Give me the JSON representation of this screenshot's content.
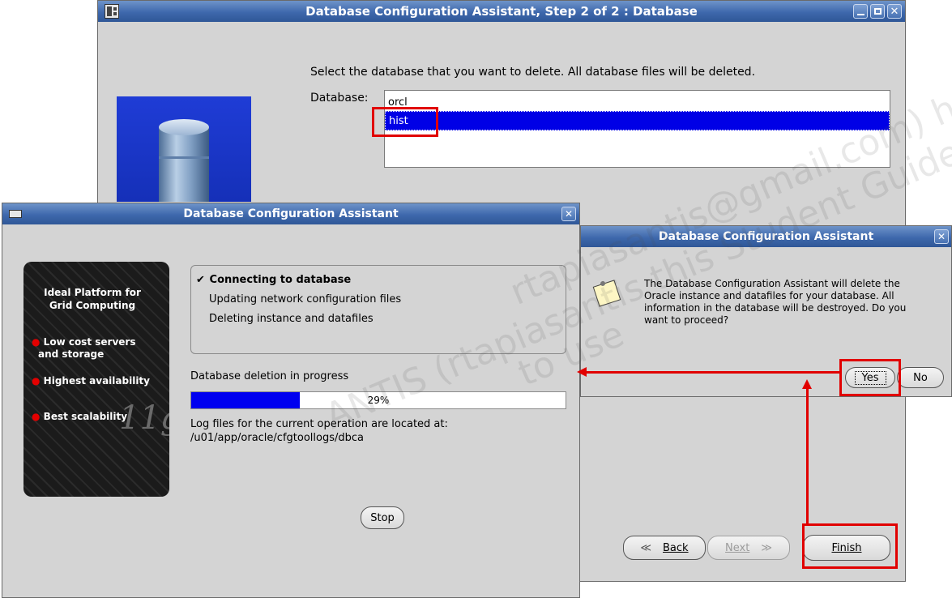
{
  "step_window": {
    "title": "Database Configuration Assistant, Step 2 of 2 : Database",
    "instruction": "Select the database that you want to delete. All database files will be deleted.",
    "database_label": "Database:",
    "databases": [
      "orcl",
      "hist"
    ],
    "selected_database": "hist",
    "buttons": {
      "back": "Back",
      "next": "Next",
      "finish": "Finish"
    }
  },
  "progress_window": {
    "title": "Database Configuration Assistant",
    "banner": {
      "headline_line1": "Ideal Platform for",
      "headline_line2": "Grid Computing",
      "bullet1_line1": "Low cost servers",
      "bullet1_line2": "and storage",
      "bullet2": "Highest availability",
      "bullet3": "Best scalability",
      "logo": "11g"
    },
    "steps": [
      {
        "label": "Connecting to database",
        "done": true
      },
      {
        "label": "Updating network configuration files",
        "done": false
      },
      {
        "label": "Deleting instance and datafiles",
        "done": false
      }
    ],
    "status": "Database deletion in progress",
    "progress_percent": 29,
    "progress_text": "29%",
    "log_line1": "Log files for the current operation are located at:",
    "log_line2": "/u01/app/oracle/cfgtoollogs/dbca",
    "stop_label": "Stop"
  },
  "confirm_dialog": {
    "title": "Database Configuration Assistant",
    "message_line1": "The Database Configuration Assistant will delete the",
    "message_line2": "Oracle instance and datafiles for your database. All",
    "message_line3": "information in the database will be destroyed. Do you",
    "message_line4": "want to proceed?",
    "yes_label": "Yes",
    "no_label": "No"
  },
  "watermark": {
    "line1": "rtapiasantis@gmail.com) has",
    "line2": "ANTIS (rtapiasantis this Student Guide.",
    "line3": "to use"
  },
  "colors": {
    "window_bg": "#d4d4d4",
    "titlebar": "#3e68ac",
    "selection": "#0000e6",
    "progress_fill": "#0000f0",
    "highlight_red": "#e10000"
  }
}
